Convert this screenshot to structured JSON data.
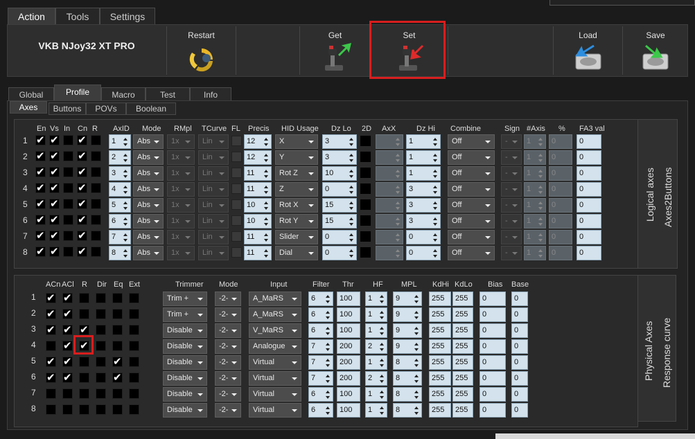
{
  "main_tabs": [
    "Action",
    "Tools",
    "Settings"
  ],
  "device_name": "VKB NJoy32 XT PRO",
  "toolbar": {
    "restart": "Restart",
    "get": "Get",
    "set": "Set",
    "load": "Load",
    "save": "Save"
  },
  "profile_tabs": [
    "Global",
    "Profile",
    "Macro",
    "Test",
    "Info"
  ],
  "sub_tabs": [
    "Axes",
    "Buttons",
    "POVs",
    "Boolean"
  ],
  "logical": {
    "side_labels": [
      "Logical axes",
      "Axes2Buttons"
    ],
    "headers": [
      "En",
      "Vs",
      "In",
      "Cn",
      "R",
      "AxID",
      "Mode",
      "RMpl",
      "TCurve",
      "FL",
      "Precis",
      "HID Usage",
      "Dz Lo",
      "2D",
      "AxX",
      "Dz Hi",
      "Combine",
      "Sign",
      "#Axis",
      "%",
      "FA3 val"
    ],
    "rows": [
      {
        "n": "1",
        "en": true,
        "vs": true,
        "in": false,
        "cn": true,
        "r": false,
        "axid": "1",
        "mode": "Abs",
        "rmpl": "1x",
        "tcurve": "Lin",
        "precis": "12",
        "hid": "X",
        "dzlo": "3",
        "dzhi": "1",
        "combine": "Off",
        "sign": "-",
        "naxis": "1",
        "pct": "0",
        "fa3": "0"
      },
      {
        "n": "2",
        "en": true,
        "vs": true,
        "in": false,
        "cn": true,
        "r": false,
        "axid": "2",
        "mode": "Abs",
        "rmpl": "1x",
        "tcurve": "Lin",
        "precis": "12",
        "hid": "Y",
        "dzlo": "3",
        "dzhi": "1",
        "combine": "Off",
        "sign": "-",
        "naxis": "1",
        "pct": "0",
        "fa3": "0"
      },
      {
        "n": "3",
        "en": true,
        "vs": true,
        "in": false,
        "cn": true,
        "r": false,
        "axid": "3",
        "mode": "Abs",
        "rmpl": "1x",
        "tcurve": "Lin",
        "precis": "11",
        "hid": "Rot Z",
        "dzlo": "10",
        "dzhi": "1",
        "combine": "Off",
        "sign": "-",
        "naxis": "1",
        "pct": "0",
        "fa3": "0"
      },
      {
        "n": "4",
        "en": true,
        "vs": true,
        "in": false,
        "cn": true,
        "r": false,
        "axid": "4",
        "mode": "Abs",
        "rmpl": "1x",
        "tcurve": "Lin",
        "precis": "11",
        "hid": "Z",
        "dzlo": "0",
        "dzhi": "3",
        "combine": "Off",
        "sign": "-",
        "naxis": "1",
        "pct": "0",
        "fa3": "0"
      },
      {
        "n": "5",
        "en": true,
        "vs": true,
        "in": false,
        "cn": true,
        "r": false,
        "axid": "5",
        "mode": "Abs",
        "rmpl": "1x",
        "tcurve": "Lin",
        "precis": "10",
        "hid": "Rot X",
        "dzlo": "15",
        "dzhi": "3",
        "combine": "Off",
        "sign": "-",
        "naxis": "1",
        "pct": "0",
        "fa3": "0"
      },
      {
        "n": "6",
        "en": true,
        "vs": true,
        "in": false,
        "cn": true,
        "r": false,
        "axid": "6",
        "mode": "Abs",
        "rmpl": "1x",
        "tcurve": "Lin",
        "precis": "10",
        "hid": "Rot Y",
        "dzlo": "15",
        "dzhi": "3",
        "combine": "Off",
        "sign": "-",
        "naxis": "1",
        "pct": "0",
        "fa3": "0"
      },
      {
        "n": "7",
        "en": true,
        "vs": true,
        "in": false,
        "cn": true,
        "r": false,
        "axid": "7",
        "mode": "Abs",
        "rmpl": "1x",
        "tcurve": "Lin",
        "precis": "11",
        "hid": "Slider",
        "dzlo": "0",
        "dzhi": "0",
        "combine": "Off",
        "sign": "-",
        "naxis": "1",
        "pct": "0",
        "fa3": "0"
      },
      {
        "n": "8",
        "en": true,
        "vs": true,
        "in": false,
        "cn": true,
        "r": false,
        "axid": "8",
        "mode": "Abs",
        "rmpl": "1x",
        "tcurve": "Lin",
        "precis": "11",
        "hid": "Dial",
        "dzlo": "0",
        "dzhi": "0",
        "combine": "Off",
        "sign": "-",
        "naxis": "1",
        "pct": "0",
        "fa3": "0"
      }
    ]
  },
  "physical": {
    "side_labels": [
      "Physical Axes",
      "Response curve"
    ],
    "headers": [
      "ACn",
      "ACl",
      "R",
      "Dir",
      "Eq",
      "Ext",
      "Trimmer",
      "Mode",
      "Input",
      "Filter",
      "Thr",
      "HF",
      "MPL",
      "KdHi",
      "KdLo",
      "Bias",
      "Base"
    ],
    "rows": [
      {
        "n": "1",
        "acn": true,
        "acl": true,
        "r": false,
        "dir": false,
        "eq": false,
        "ext": false,
        "trimmer": "Trim +",
        "mode": "-2-",
        "input": "A_MaRS",
        "filter": "6",
        "thr": "100",
        "hf": "1",
        "mpl": "9",
        "kdhi": "255",
        "kdlo": "255",
        "bias": "0",
        "base": "0"
      },
      {
        "n": "2",
        "acn": true,
        "acl": true,
        "r": false,
        "dir": false,
        "eq": false,
        "ext": false,
        "trimmer": "Trim +",
        "mode": "-2-",
        "input": "A_MaRS",
        "filter": "6",
        "thr": "100",
        "hf": "1",
        "mpl": "9",
        "kdhi": "255",
        "kdlo": "255",
        "bias": "0",
        "base": "0"
      },
      {
        "n": "3",
        "acn": true,
        "acl": true,
        "r": true,
        "dir": false,
        "eq": false,
        "ext": false,
        "trimmer": "Disable",
        "mode": "-2-",
        "input": "V_MaRS",
        "filter": "6",
        "thr": "100",
        "hf": "1",
        "mpl": "9",
        "kdhi": "255",
        "kdlo": "255",
        "bias": "0",
        "base": "0"
      },
      {
        "n": "4",
        "acn": false,
        "acl": true,
        "r": true,
        "dir": false,
        "eq": false,
        "ext": false,
        "trimmer": "Disable",
        "mode": "-2-",
        "input": "Analogue",
        "filter": "7",
        "thr": "200",
        "hf": "2",
        "mpl": "9",
        "kdhi": "255",
        "kdlo": "255",
        "bias": "0",
        "base": "0"
      },
      {
        "n": "5",
        "acn": true,
        "acl": true,
        "r": false,
        "dir": false,
        "eq": true,
        "ext": false,
        "trimmer": "Disable",
        "mode": "-2-",
        "input": "Virtual",
        "filter": "7",
        "thr": "200",
        "hf": "1",
        "mpl": "8",
        "kdhi": "255",
        "kdlo": "255",
        "bias": "0",
        "base": "0"
      },
      {
        "n": "6",
        "acn": true,
        "acl": true,
        "r": false,
        "dir": false,
        "eq": true,
        "ext": false,
        "trimmer": "Disable",
        "mode": "-2-",
        "input": "Virtual",
        "filter": "7",
        "thr": "200",
        "hf": "2",
        "mpl": "8",
        "kdhi": "255",
        "kdlo": "255",
        "bias": "0",
        "base": "0"
      },
      {
        "n": "7",
        "acn": false,
        "acl": false,
        "r": false,
        "dir": false,
        "eq": false,
        "ext": false,
        "trimmer": "Disable",
        "mode": "-2-",
        "input": "Virtual",
        "filter": "6",
        "thr": "100",
        "hf": "1",
        "mpl": "8",
        "kdhi": "255",
        "kdlo": "255",
        "bias": "0",
        "base": "0"
      },
      {
        "n": "8",
        "acn": false,
        "acl": false,
        "r": false,
        "dir": false,
        "eq": false,
        "ext": false,
        "trimmer": "Disable",
        "mode": "-2-",
        "input": "Virtual",
        "filter": "6",
        "thr": "100",
        "hf": "1",
        "mpl": "8",
        "kdhi": "255",
        "kdlo": "255",
        "bias": "0",
        "base": "0"
      }
    ]
  },
  "colors": {
    "highlight": "#d81e1e",
    "field": "#d3e2ec",
    "background": "#1b1b1b"
  }
}
